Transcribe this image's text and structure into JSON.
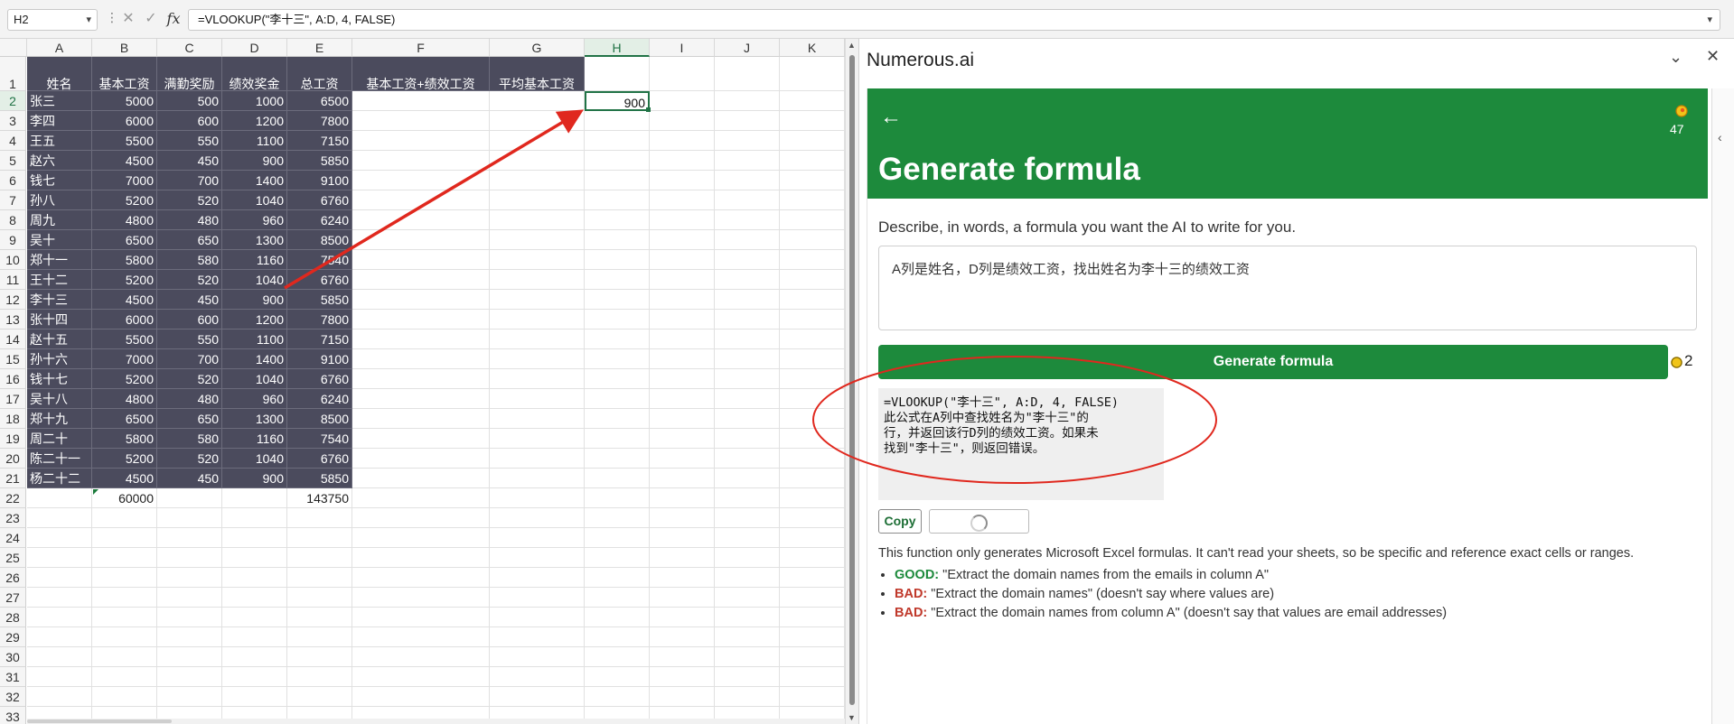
{
  "formula_bar": {
    "name_box": "H2",
    "formula": "=VLOOKUP(\"李十三\", A:D, 4, FALSE)",
    "cancel_icon": "✕",
    "enter_icon": "✓",
    "fx_label": "fx"
  },
  "sheet": {
    "columns": [
      "A",
      "B",
      "C",
      "D",
      "E",
      "F",
      "G",
      "H",
      "I",
      "J",
      "K"
    ],
    "rows": [
      "1",
      "2",
      "3",
      "4",
      "5",
      "6",
      "7",
      "8",
      "9",
      "10",
      "11",
      "12",
      "13",
      "14",
      "15",
      "16",
      "17",
      "18",
      "19",
      "20",
      "21",
      "22",
      "23",
      "24",
      "25",
      "26",
      "27",
      "28",
      "29",
      "30",
      "31",
      "32",
      "33"
    ],
    "headers": [
      "姓名",
      "基本工资",
      "满勤奖励",
      "绩效奖金",
      "总工资",
      "基本工资+绩效工资",
      "平均基本工资"
    ],
    "data": [
      [
        "张三",
        "5000",
        "500",
        "1000",
        "6500"
      ],
      [
        "李四",
        "6000",
        "600",
        "1200",
        "7800"
      ],
      [
        "王五",
        "5500",
        "550",
        "1100",
        "7150"
      ],
      [
        "赵六",
        "4500",
        "450",
        "900",
        "5850"
      ],
      [
        "钱七",
        "7000",
        "700",
        "1400",
        "9100"
      ],
      [
        "孙八",
        "5200",
        "520",
        "1040",
        "6760"
      ],
      [
        "周九",
        "4800",
        "480",
        "960",
        "6240"
      ],
      [
        "吴十",
        "6500",
        "650",
        "1300",
        "8500"
      ],
      [
        "郑十一",
        "5800",
        "580",
        "1160",
        "7540"
      ],
      [
        "王十二",
        "5200",
        "520",
        "1040",
        "6760"
      ],
      [
        "李十三",
        "4500",
        "450",
        "900",
        "5850"
      ],
      [
        "张十四",
        "6000",
        "600",
        "1200",
        "7800"
      ],
      [
        "赵十五",
        "5500",
        "550",
        "1100",
        "7150"
      ],
      [
        "孙十六",
        "7000",
        "700",
        "1400",
        "9100"
      ],
      [
        "钱十七",
        "5200",
        "520",
        "1040",
        "6760"
      ],
      [
        "吴十八",
        "4800",
        "480",
        "960",
        "6240"
      ],
      [
        "郑十九",
        "6500",
        "650",
        "1300",
        "8500"
      ],
      [
        "周二十",
        "5800",
        "580",
        "1160",
        "7540"
      ],
      [
        "陈二十一",
        "5200",
        "520",
        "1040",
        "6760"
      ],
      [
        "杨二十二",
        "4500",
        "450",
        "900",
        "5850"
      ]
    ],
    "totals": {
      "B": "60000",
      "E": "143750"
    },
    "active_cell_value": "900",
    "selected_column": "H",
    "selected_row": "2"
  },
  "pane": {
    "title": "Numerous.ai",
    "collapse_icon": "chevron-down-icon",
    "close_icon": "close-icon",
    "back_icon": "arrow-left-icon",
    "credits": "47",
    "heading": "Generate formula",
    "description": "Describe, in words, a formula you want the AI to write for you.",
    "prompt": "A列是姓名，D列是绩效工资，找出姓名为李十三的绩效工资",
    "generate_button": "Generate formula",
    "cost": "2",
    "result": "=VLOOKUP(\"李十三\", A:D, 4, FALSE)\n此公式在A列中查找姓名为\"李十三\"的\n行，并返回该行D列的绩效工资。如果未\n找到\"李十三\"，则返回错误。",
    "copy_button": "Copy",
    "note": "This function only generates Microsoft Excel formulas. It can't read your sheets, so be specific and reference exact cells or ranges.",
    "tips": [
      {
        "tag": "GOOD:",
        "text": " \"Extract the domain names from the emails in column A\""
      },
      {
        "tag": "BAD:",
        "text": " \"Extract the domain names\" (doesn't say where values are)"
      },
      {
        "tag": "BAD:",
        "text": " \"Extract the domain names from column A\" (doesn't say that values are email addresses)"
      }
    ]
  },
  "colors": {
    "excel_green": "#217346",
    "banner_green": "#1d8a3c",
    "dark_cell": "#4b4b5d",
    "annotation_red": "#e0281e"
  }
}
